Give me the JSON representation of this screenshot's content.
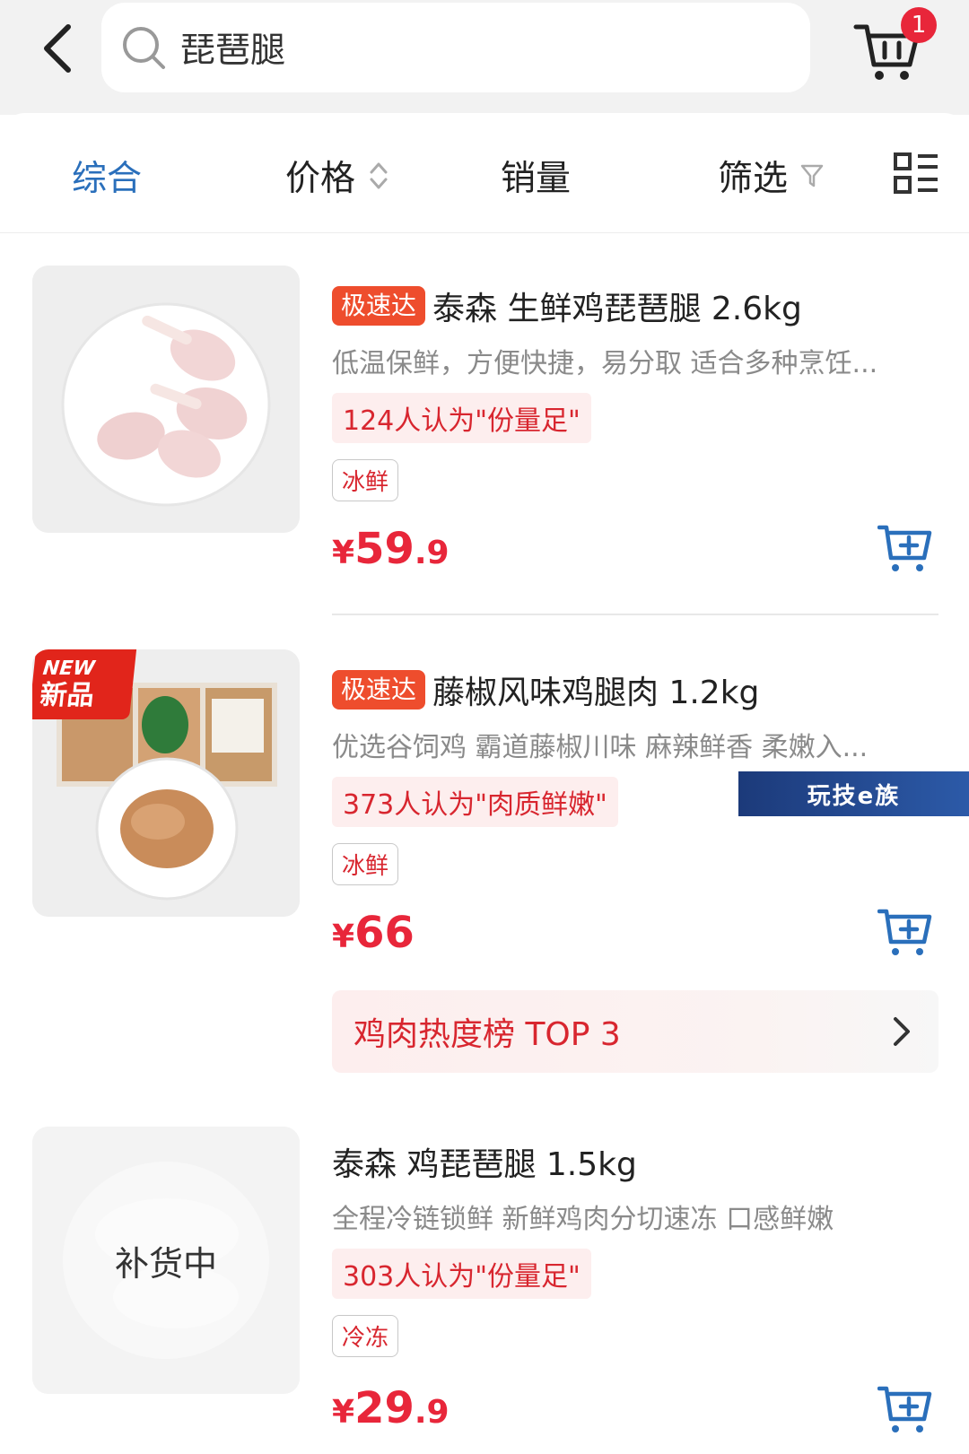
{
  "search": {
    "query": "琵琶腿"
  },
  "cart": {
    "badge_count": "1"
  },
  "sort_bar": {
    "items": [
      {
        "label": "综合",
        "active": true
      },
      {
        "label": "价格"
      },
      {
        "label": "销量"
      },
      {
        "label": "筛选"
      }
    ]
  },
  "products": [
    {
      "speed_tag": "极速达",
      "title": "泰森 生鲜鸡琵琶腿 2.6kg",
      "subtitle": "低温保鲜，方便快捷，易分取 适合多种烹饪...",
      "review": "124人认为\"份量足\"",
      "attr": "冰鲜",
      "price_symbol": "¥",
      "price_int": "59",
      "price_dec": ".9"
    },
    {
      "badge_line1": "NEW",
      "badge_line2": "新品",
      "speed_tag": "极速达",
      "title": "藤椒风味鸡腿肉 1.2kg",
      "subtitle": "优选谷饲鸡 霸道藤椒川味 麻辣鲜香 柔嫩入...",
      "review": "373人认为\"肉质鲜嫩\"",
      "attr": "冰鲜",
      "price_symbol": "¥",
      "price_int": "66",
      "price_dec": ""
    },
    {
      "status": "补货中",
      "title": "泰森 鸡琵琶腿 1.5kg",
      "subtitle": "全程冷链锁鲜 新鲜鸡肉分切速冻 口感鲜嫩",
      "review": "303人认为\"份量足\"",
      "attr": "冷冻",
      "price_symbol": "¥",
      "price_int": "29",
      "price_dec": ".9"
    }
  ],
  "rank_banner": {
    "label": "鸡肉热度榜 TOP 3"
  },
  "watermark": {
    "text": "玩技e族"
  },
  "colors": {
    "accent_blue": "#2a6fbb",
    "price_red": "#e8263a",
    "tag_orange": "#ee4d2d"
  }
}
